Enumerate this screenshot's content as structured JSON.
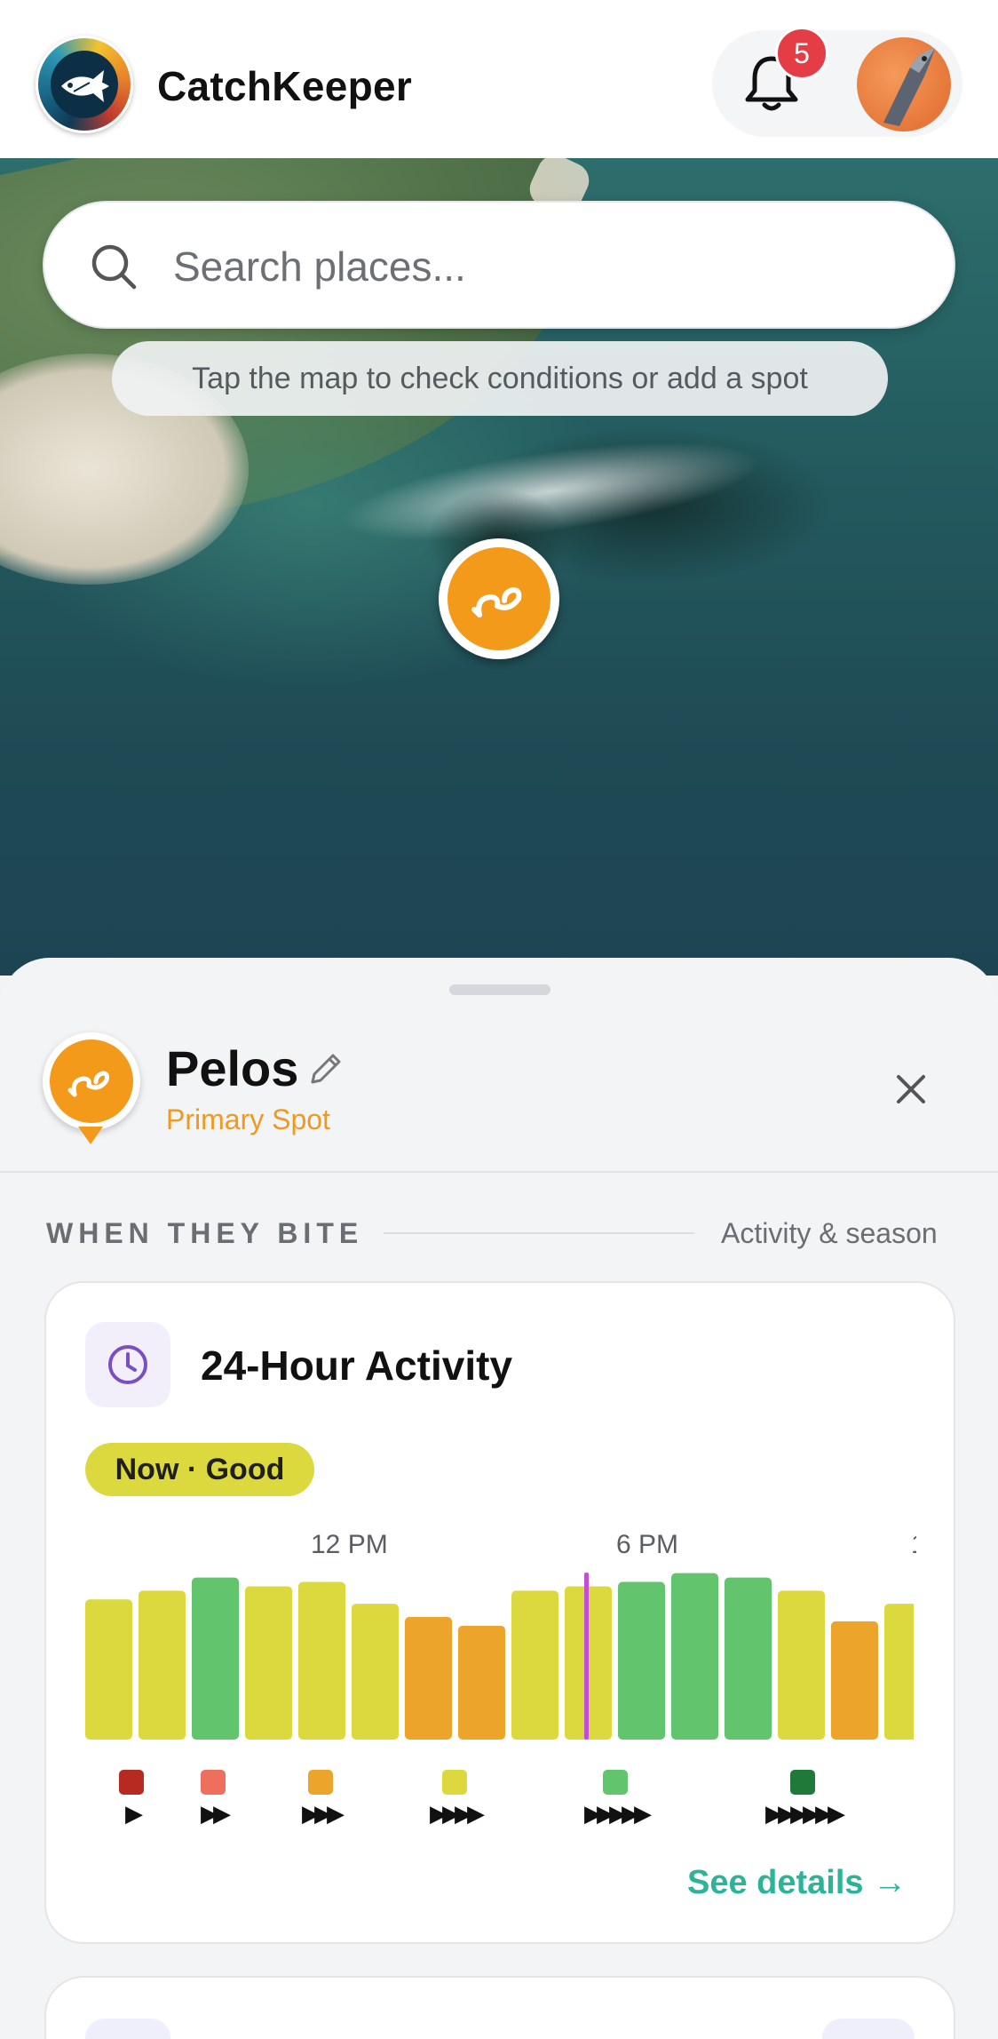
{
  "header": {
    "app_title": "CatchKeeper",
    "notification_count": "5"
  },
  "map": {
    "search_placeholder": "Search places...",
    "hint": "Tap the map to check conditions or add a spot"
  },
  "spot": {
    "name": "Pelos",
    "subtitle": "Primary Spot"
  },
  "section": {
    "title": "WHEN THEY BITE",
    "meta": "Activity & season"
  },
  "activity_card": {
    "title": "24-Hour Activity",
    "now_badge": "Now · Good",
    "see_details": "See details →"
  },
  "legend": [
    {
      "color": "#b72a22",
      "fish": 1
    },
    {
      "color": "#ef6f5e",
      "fish": 2
    },
    {
      "color": "#eca42a",
      "fish": 3
    },
    {
      "color": "#dcd93e",
      "fish": 4
    },
    {
      "color": "#63c46e",
      "fish": 5
    },
    {
      "color": "#1f7a3a",
      "fish": 6
    }
  ],
  "colors": {
    "accent_orange": "#f39a1a",
    "accent_teal": "#2cb398",
    "now_line": "#c24dd6",
    "badge_red": "#e53d46"
  },
  "chart_data": {
    "type": "bar",
    "x_tick_labels": [
      "12 PM",
      "6 PM"
    ],
    "now_index": 9,
    "values": [
      3.2,
      3.4,
      3.7,
      3.5,
      3.6,
      3.1,
      2.8,
      2.6,
      3.4,
      3.5,
      3.6,
      3.8,
      3.7,
      3.4,
      2.7,
      3.1
    ],
    "colors": [
      "#dcd93e",
      "#dcd93e",
      "#63c46e",
      "#dcd93e",
      "#dcd93e",
      "#dcd93e",
      "#eca42a",
      "#eca42a",
      "#dcd93e",
      "#dcd93e",
      "#63c46e",
      "#63c46e",
      "#63c46e",
      "#dcd93e",
      "#eca42a",
      "#dcd93e"
    ],
    "ylim": [
      0,
      4.5
    ],
    "grid": false,
    "legend_placement": "bottom"
  }
}
